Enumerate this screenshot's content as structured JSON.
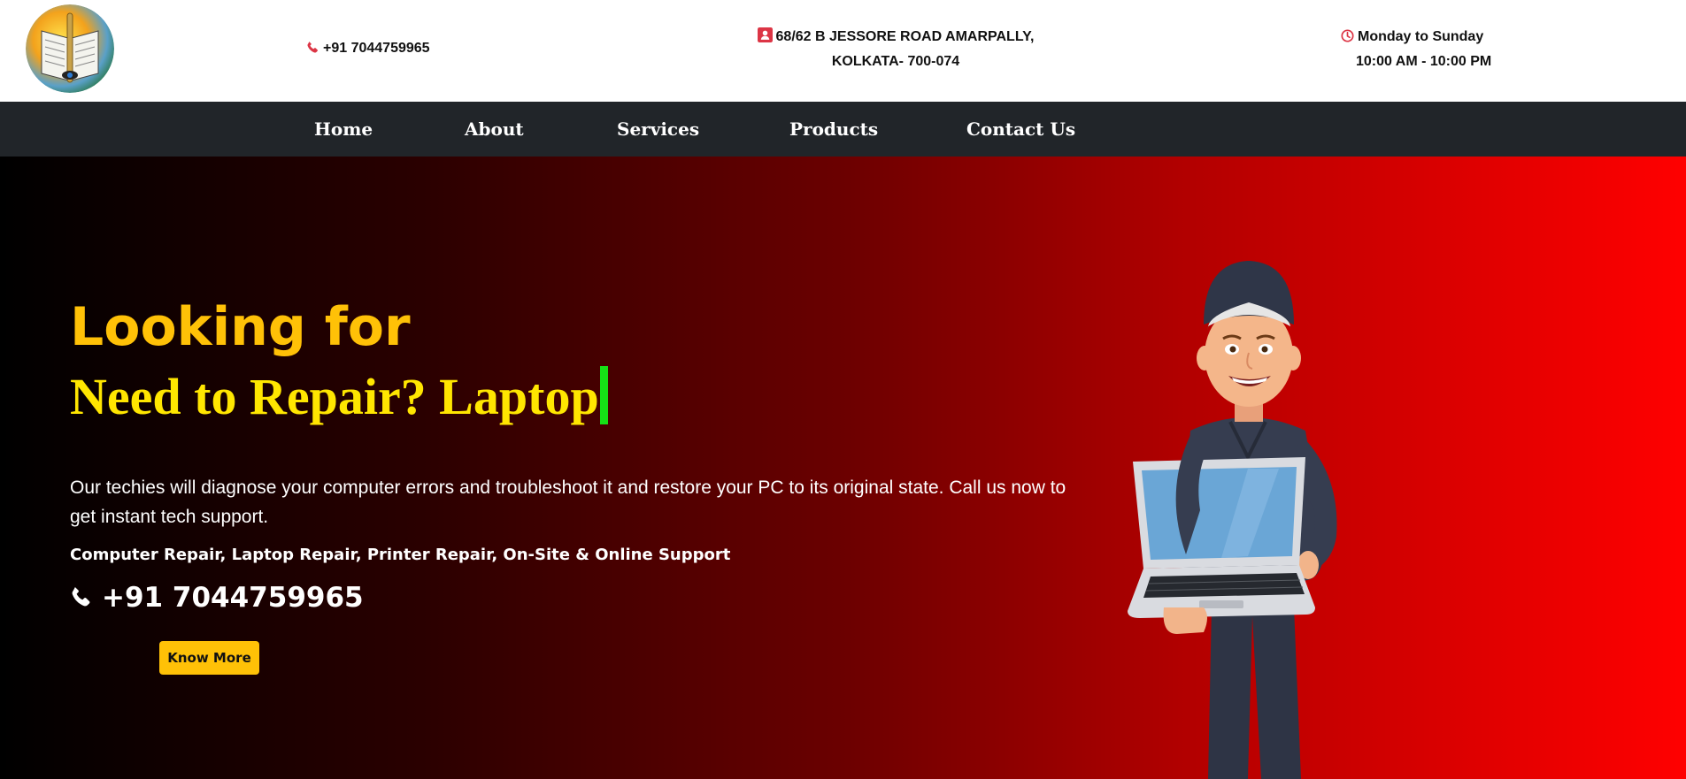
{
  "header": {
    "logo_icon": "book-globe-logo",
    "phone": "+91 7044759965",
    "address_line1": "68/62 B JESSORE ROAD AMARPALLY,",
    "address_line2": "KOLKATA- 700-074",
    "hours_line1": "Monday to Sunday",
    "hours_line2": "10:00 AM - 10:00 PM"
  },
  "nav": {
    "items": [
      {
        "label": "Home"
      },
      {
        "label": "About"
      },
      {
        "label": "Services"
      },
      {
        "label": "Products"
      },
      {
        "label": "Contact Us"
      }
    ]
  },
  "hero": {
    "title": "Looking for",
    "subtitle": "Need to Repair? Laptop",
    "description": "Our techies will diagnose your computer errors and troubleshoot it and restore your PC to its original state. Call us now to get instant tech support.",
    "services": "Computer Repair, Laptop Repair, Printer Repair, On-Site & Online Support",
    "phone": "+91 7044759965",
    "button_label": "Know More",
    "illustration_icon": "technician-with-laptop"
  },
  "colors": {
    "accent_yellow": "#ffc107",
    "nav_bg": "#212529",
    "icon_red": "#dc3545",
    "caret_green": "#16e016"
  }
}
